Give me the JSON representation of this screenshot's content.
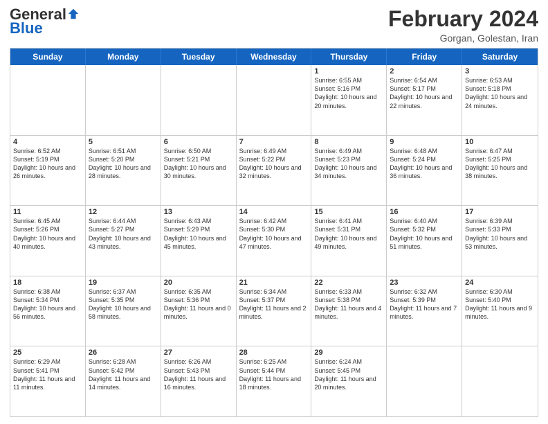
{
  "logo": {
    "general": "General",
    "blue": "Blue"
  },
  "title": "February 2024",
  "subtitle": "Gorgan, Golestan, Iran",
  "days_of_week": [
    "Sunday",
    "Monday",
    "Tuesday",
    "Wednesday",
    "Thursday",
    "Friday",
    "Saturday"
  ],
  "weeks": [
    [
      {
        "day": "",
        "content": ""
      },
      {
        "day": "",
        "content": ""
      },
      {
        "day": "",
        "content": ""
      },
      {
        "day": "",
        "content": ""
      },
      {
        "day": "1",
        "content": "Sunrise: 6:55 AM\nSunset: 5:16 PM\nDaylight: 10 hours and 20 minutes."
      },
      {
        "day": "2",
        "content": "Sunrise: 6:54 AM\nSunset: 5:17 PM\nDaylight: 10 hours and 22 minutes."
      },
      {
        "day": "3",
        "content": "Sunrise: 6:53 AM\nSunset: 5:18 PM\nDaylight: 10 hours and 24 minutes."
      }
    ],
    [
      {
        "day": "4",
        "content": "Sunrise: 6:52 AM\nSunset: 5:19 PM\nDaylight: 10 hours and 26 minutes."
      },
      {
        "day": "5",
        "content": "Sunrise: 6:51 AM\nSunset: 5:20 PM\nDaylight: 10 hours and 28 minutes."
      },
      {
        "day": "6",
        "content": "Sunrise: 6:50 AM\nSunset: 5:21 PM\nDaylight: 10 hours and 30 minutes."
      },
      {
        "day": "7",
        "content": "Sunrise: 6:49 AM\nSunset: 5:22 PM\nDaylight: 10 hours and 32 minutes."
      },
      {
        "day": "8",
        "content": "Sunrise: 6:49 AM\nSunset: 5:23 PM\nDaylight: 10 hours and 34 minutes."
      },
      {
        "day": "9",
        "content": "Sunrise: 6:48 AM\nSunset: 5:24 PM\nDaylight: 10 hours and 36 minutes."
      },
      {
        "day": "10",
        "content": "Sunrise: 6:47 AM\nSunset: 5:25 PM\nDaylight: 10 hours and 38 minutes."
      }
    ],
    [
      {
        "day": "11",
        "content": "Sunrise: 6:45 AM\nSunset: 5:26 PM\nDaylight: 10 hours and 40 minutes."
      },
      {
        "day": "12",
        "content": "Sunrise: 6:44 AM\nSunset: 5:27 PM\nDaylight: 10 hours and 43 minutes."
      },
      {
        "day": "13",
        "content": "Sunrise: 6:43 AM\nSunset: 5:29 PM\nDaylight: 10 hours and 45 minutes."
      },
      {
        "day": "14",
        "content": "Sunrise: 6:42 AM\nSunset: 5:30 PM\nDaylight: 10 hours and 47 minutes."
      },
      {
        "day": "15",
        "content": "Sunrise: 6:41 AM\nSunset: 5:31 PM\nDaylight: 10 hours and 49 minutes."
      },
      {
        "day": "16",
        "content": "Sunrise: 6:40 AM\nSunset: 5:32 PM\nDaylight: 10 hours and 51 minutes."
      },
      {
        "day": "17",
        "content": "Sunrise: 6:39 AM\nSunset: 5:33 PM\nDaylight: 10 hours and 53 minutes."
      }
    ],
    [
      {
        "day": "18",
        "content": "Sunrise: 6:38 AM\nSunset: 5:34 PM\nDaylight: 10 hours and 56 minutes."
      },
      {
        "day": "19",
        "content": "Sunrise: 6:37 AM\nSunset: 5:35 PM\nDaylight: 10 hours and 58 minutes."
      },
      {
        "day": "20",
        "content": "Sunrise: 6:35 AM\nSunset: 5:36 PM\nDaylight: 11 hours and 0 minutes."
      },
      {
        "day": "21",
        "content": "Sunrise: 6:34 AM\nSunset: 5:37 PM\nDaylight: 11 hours and 2 minutes."
      },
      {
        "day": "22",
        "content": "Sunrise: 6:33 AM\nSunset: 5:38 PM\nDaylight: 11 hours and 4 minutes."
      },
      {
        "day": "23",
        "content": "Sunrise: 6:32 AM\nSunset: 5:39 PM\nDaylight: 11 hours and 7 minutes."
      },
      {
        "day": "24",
        "content": "Sunrise: 6:30 AM\nSunset: 5:40 PM\nDaylight: 11 hours and 9 minutes."
      }
    ],
    [
      {
        "day": "25",
        "content": "Sunrise: 6:29 AM\nSunset: 5:41 PM\nDaylight: 11 hours and 11 minutes."
      },
      {
        "day": "26",
        "content": "Sunrise: 6:28 AM\nSunset: 5:42 PM\nDaylight: 11 hours and 14 minutes."
      },
      {
        "day": "27",
        "content": "Sunrise: 6:26 AM\nSunset: 5:43 PM\nDaylight: 11 hours and 16 minutes."
      },
      {
        "day": "28",
        "content": "Sunrise: 6:25 AM\nSunset: 5:44 PM\nDaylight: 11 hours and 18 minutes."
      },
      {
        "day": "29",
        "content": "Sunrise: 6:24 AM\nSunset: 5:45 PM\nDaylight: 11 hours and 20 minutes."
      },
      {
        "day": "",
        "content": ""
      },
      {
        "day": "",
        "content": ""
      }
    ]
  ]
}
